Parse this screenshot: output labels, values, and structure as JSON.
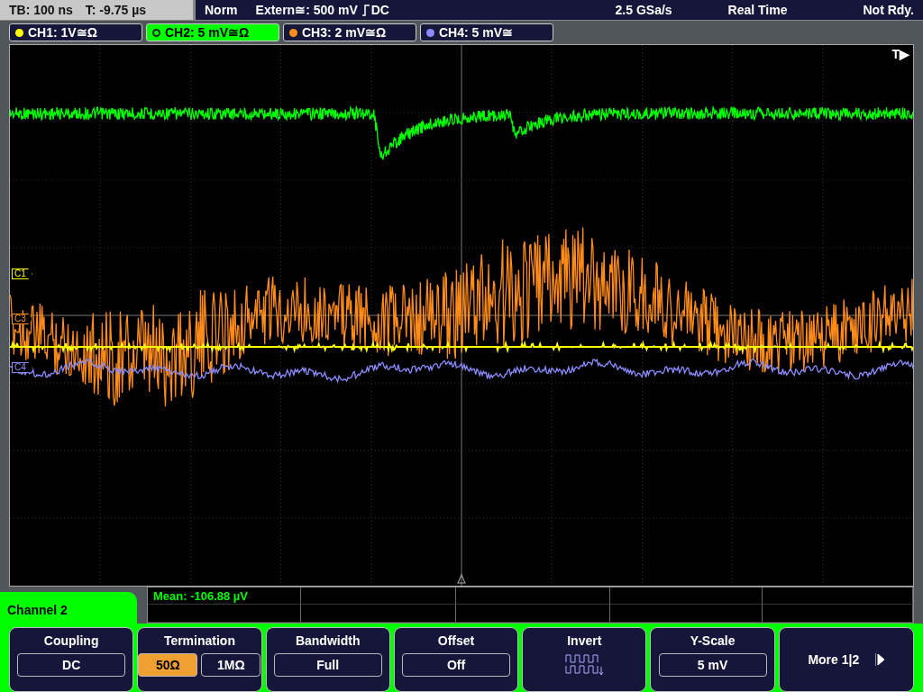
{
  "status_bar": {
    "timebase": "TB: 100 ns",
    "trigger_time": "T: -9.75 µs",
    "mode": "Norm",
    "trigger_source": "Extern≅: 500 mV",
    "trigger_coupling": "DC",
    "sample_rate": "2.5 GSa/s",
    "acquisition": "Real Time",
    "state": "Not Rdy."
  },
  "channels": [
    {
      "label": "CH1: 1V≅Ω",
      "color": "#ffff00",
      "selected": false,
      "marker": "C1"
    },
    {
      "label": "CH2: 5 mV≅Ω",
      "color": "#00ff00",
      "selected": true
    },
    {
      "label": "CH3: 2 mV≅Ω",
      "color": "#ff8c1a",
      "selected": false,
      "marker": "C3"
    },
    {
      "label": "CH4: 5 mV≅",
      "color": "#8c8cff",
      "selected": false,
      "marker": "C4"
    }
  ],
  "trigger_marker": "T▶",
  "menu_title": "Channel 2",
  "measurement": "Mean: -106.88 µV",
  "softkeys": [
    {
      "kind": "select",
      "title": "Coupling",
      "value": "DC"
    },
    {
      "kind": "toggle",
      "title": "Termination",
      "options": [
        {
          "label": "50Ω",
          "selected": true
        },
        {
          "label": "1MΩ",
          "selected": false
        }
      ]
    },
    {
      "kind": "select",
      "title": "Bandwidth",
      "value": "Full"
    },
    {
      "kind": "select",
      "title": "Offset",
      "value": "Off"
    },
    {
      "kind": "icon",
      "title": "Invert"
    },
    {
      "kind": "select",
      "title": "Y-Scale",
      "value": "5 mV"
    },
    {
      "kind": "more",
      "title": "More 1|2"
    }
  ]
}
